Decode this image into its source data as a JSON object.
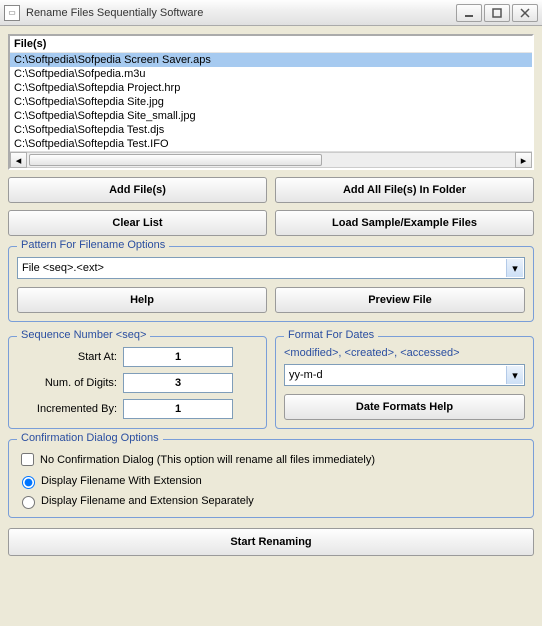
{
  "window": {
    "title": "Rename Files Sequentially Software"
  },
  "fileListHeader": "File(s)",
  "files": [
    "C:\\Softpedia\\Sofpedia Screen Saver.aps",
    "C:\\Softpedia\\Sofpedia.m3u",
    "C:\\Softpedia\\Softepdia Project.hrp",
    "C:\\Softpedia\\Softepdia Site.jpg",
    "C:\\Softpedia\\Softepdia Site_small.jpg",
    "C:\\Softpedia\\Softepdia Test.djs",
    "C:\\Softpedia\\Softepdia Test.IFO"
  ],
  "selectedIndex": 0,
  "buttons": {
    "addFiles": "Add File(s)",
    "addAllInFolder": "Add All File(s) In Folder",
    "clearList": "Clear List",
    "loadSample": "Load Sample/Example Files",
    "help": "Help",
    "previewFile": "Preview File",
    "dateFormatsHelp": "Date Formats Help",
    "startRenaming": "Start Renaming"
  },
  "patternGroup": {
    "legend": "Pattern For Filename Options",
    "value": "File <seq>.<ext>"
  },
  "sequenceGroup": {
    "legend": "Sequence Number <seq>",
    "startAtLabel": "Start At:",
    "startAt": "1",
    "numDigitsLabel": "Num. of Digits:",
    "numDigits": "3",
    "incrementedByLabel": "Incremented By:",
    "incrementedBy": "1"
  },
  "datesGroup": {
    "legend": "Format For Dates",
    "note": "<modified>, <created>, <accessed>",
    "value": "yy-m-d"
  },
  "confirmGroup": {
    "legend": "Confirmation Dialog Options",
    "noConfirm": "No Confirmation Dialog (This option will rename all files immediately)",
    "withExt": "Display Filename With Extension",
    "separate": "Display Filename and Extension Separately"
  }
}
